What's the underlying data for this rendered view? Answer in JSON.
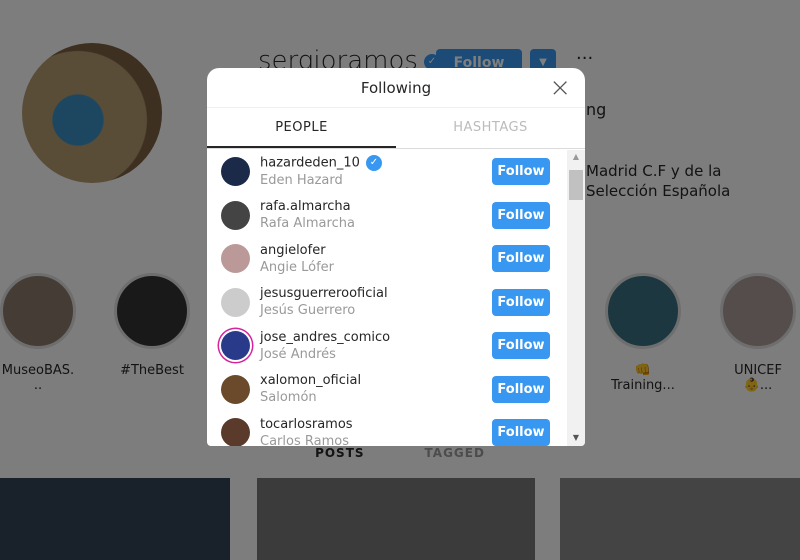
{
  "profile": {
    "username": "sergioramos",
    "follow": "Follow",
    "dropdown": "▼",
    "more": "···",
    "stat": "ng",
    "bio": "Madrid C.F y de la Selección Española"
  },
  "highlights": [
    {
      "label": "MuseoBAS..."
    },
    {
      "label": "#TheBest"
    },
    {
      "label": "👊Training..."
    },
    {
      "label": "UNICEF 👶..."
    }
  ],
  "profile_tabs": {
    "posts": "POSTS",
    "tagged": "TAGGED"
  },
  "modal": {
    "title": "Following",
    "close": "×",
    "tabs": [
      {
        "label": "PEOPLE",
        "active": true
      },
      {
        "label": "HASHTAGS",
        "active": false
      }
    ],
    "users": [
      {
        "username": "hazardeden_10",
        "name": "Eden Hazard",
        "verified": true,
        "button": "Follow"
      },
      {
        "username": "rafa.almarcha",
        "name": "Rafa Almarcha",
        "button": "Follow"
      },
      {
        "username": "angielofer",
        "name": "Angie Lófer",
        "button": "Follow"
      },
      {
        "username": "jesusguerrerooficial",
        "name": "Jesús Guerrero",
        "button": "Follow"
      },
      {
        "username": "jose_andres_comico",
        "name": "José Andrés",
        "story": true,
        "button": "Follow"
      },
      {
        "username": "xalomon_oficial",
        "name": "Salomón",
        "button": "Follow"
      },
      {
        "username": "tocarlosramos",
        "name": "Carlos Ramos",
        "button": "Follow"
      }
    ]
  },
  "colors": {
    "accent": "#3897f0"
  }
}
